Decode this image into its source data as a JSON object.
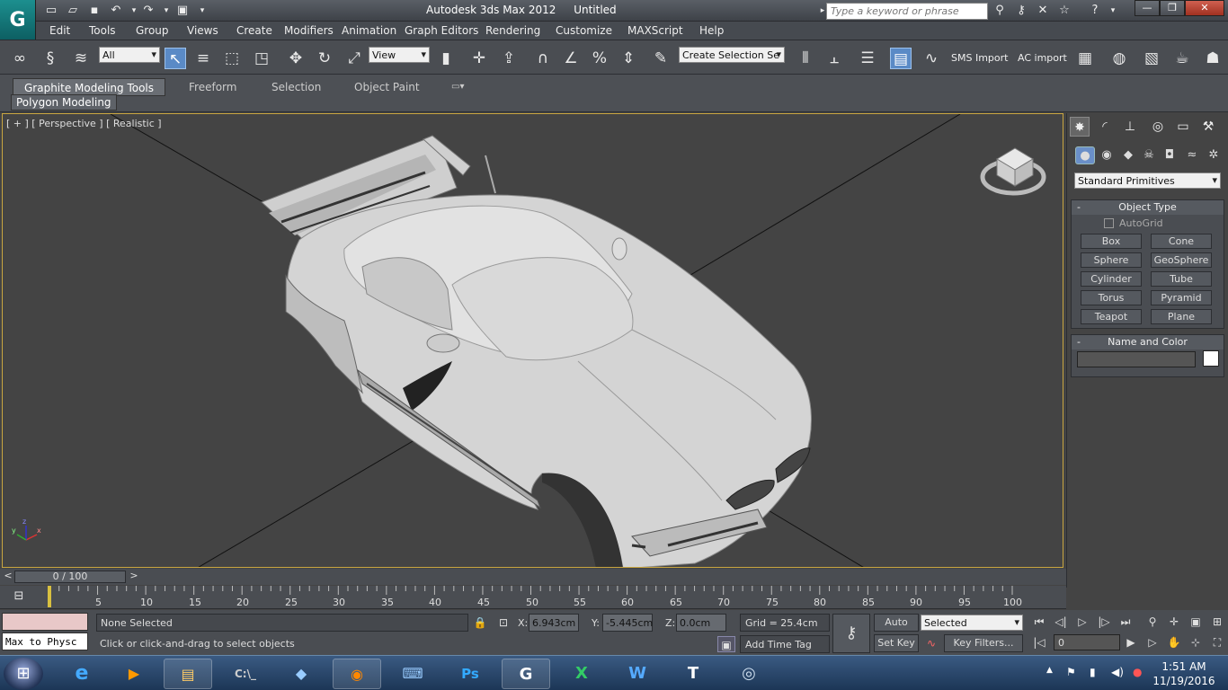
{
  "titlebar": {
    "app_name": "Autodesk 3ds Max  2012",
    "document": "Untitled",
    "search_placeholder": "Type a keyword or phrase"
  },
  "menu": [
    "Edit",
    "Tools",
    "Group",
    "Views",
    "Create",
    "Modifiers",
    "Animation",
    "Graph Editors",
    "Rendering",
    "Customize",
    "MAXScript",
    "Help"
  ],
  "toolbar": {
    "filter": "All",
    "ref_coord": "View",
    "selection_set_placeholder": "Create Selection Se",
    "sms_import": "SMS Import",
    "ac_import": "AC import"
  },
  "ribbon": {
    "tabs": [
      "Graphite Modeling Tools",
      "Freeform",
      "Selection",
      "Object Paint"
    ],
    "panel": "Polygon Modeling"
  },
  "viewport": {
    "label": "[ + ] [ Perspective ] [ Realistic ]"
  },
  "command_panel": {
    "category": "Standard Primitives",
    "object_type_title": "Object Type",
    "autogrid": "AutoGrid",
    "buttons": [
      "Box",
      "Cone",
      "Sphere",
      "GeoSphere",
      "Cylinder",
      "Tube",
      "Torus",
      "Pyramid",
      "Teapot",
      "Plane"
    ],
    "name_color_title": "Name and Color"
  },
  "timeslider": {
    "frame_label": "0 / 100",
    "ticks": [
      "5",
      "10",
      "15",
      "20",
      "25",
      "30",
      "35",
      "40",
      "45",
      "50",
      "55",
      "60",
      "65",
      "70",
      "75",
      "80",
      "85",
      "90",
      "95",
      "100"
    ]
  },
  "status": {
    "script_listener": "Max to Physc",
    "selection": "None Selected",
    "prompt": "Click or click-and-drag to select objects",
    "x_label": "X:",
    "x": "6.943cm",
    "y_label": "Y:",
    "y": "-5.445cm",
    "z_label": "Z:",
    "z": "0.0cm",
    "grid": "Grid = 25.4cm",
    "add_time_tag": "Add Time Tag",
    "auto_key": "Auto Key",
    "set_key": "Set Key",
    "key_mode": "Selected",
    "key_filters": "Key Filters...",
    "frame": "0"
  },
  "taskbar": {
    "time": "1:51 AM",
    "date": "11/19/2016"
  }
}
